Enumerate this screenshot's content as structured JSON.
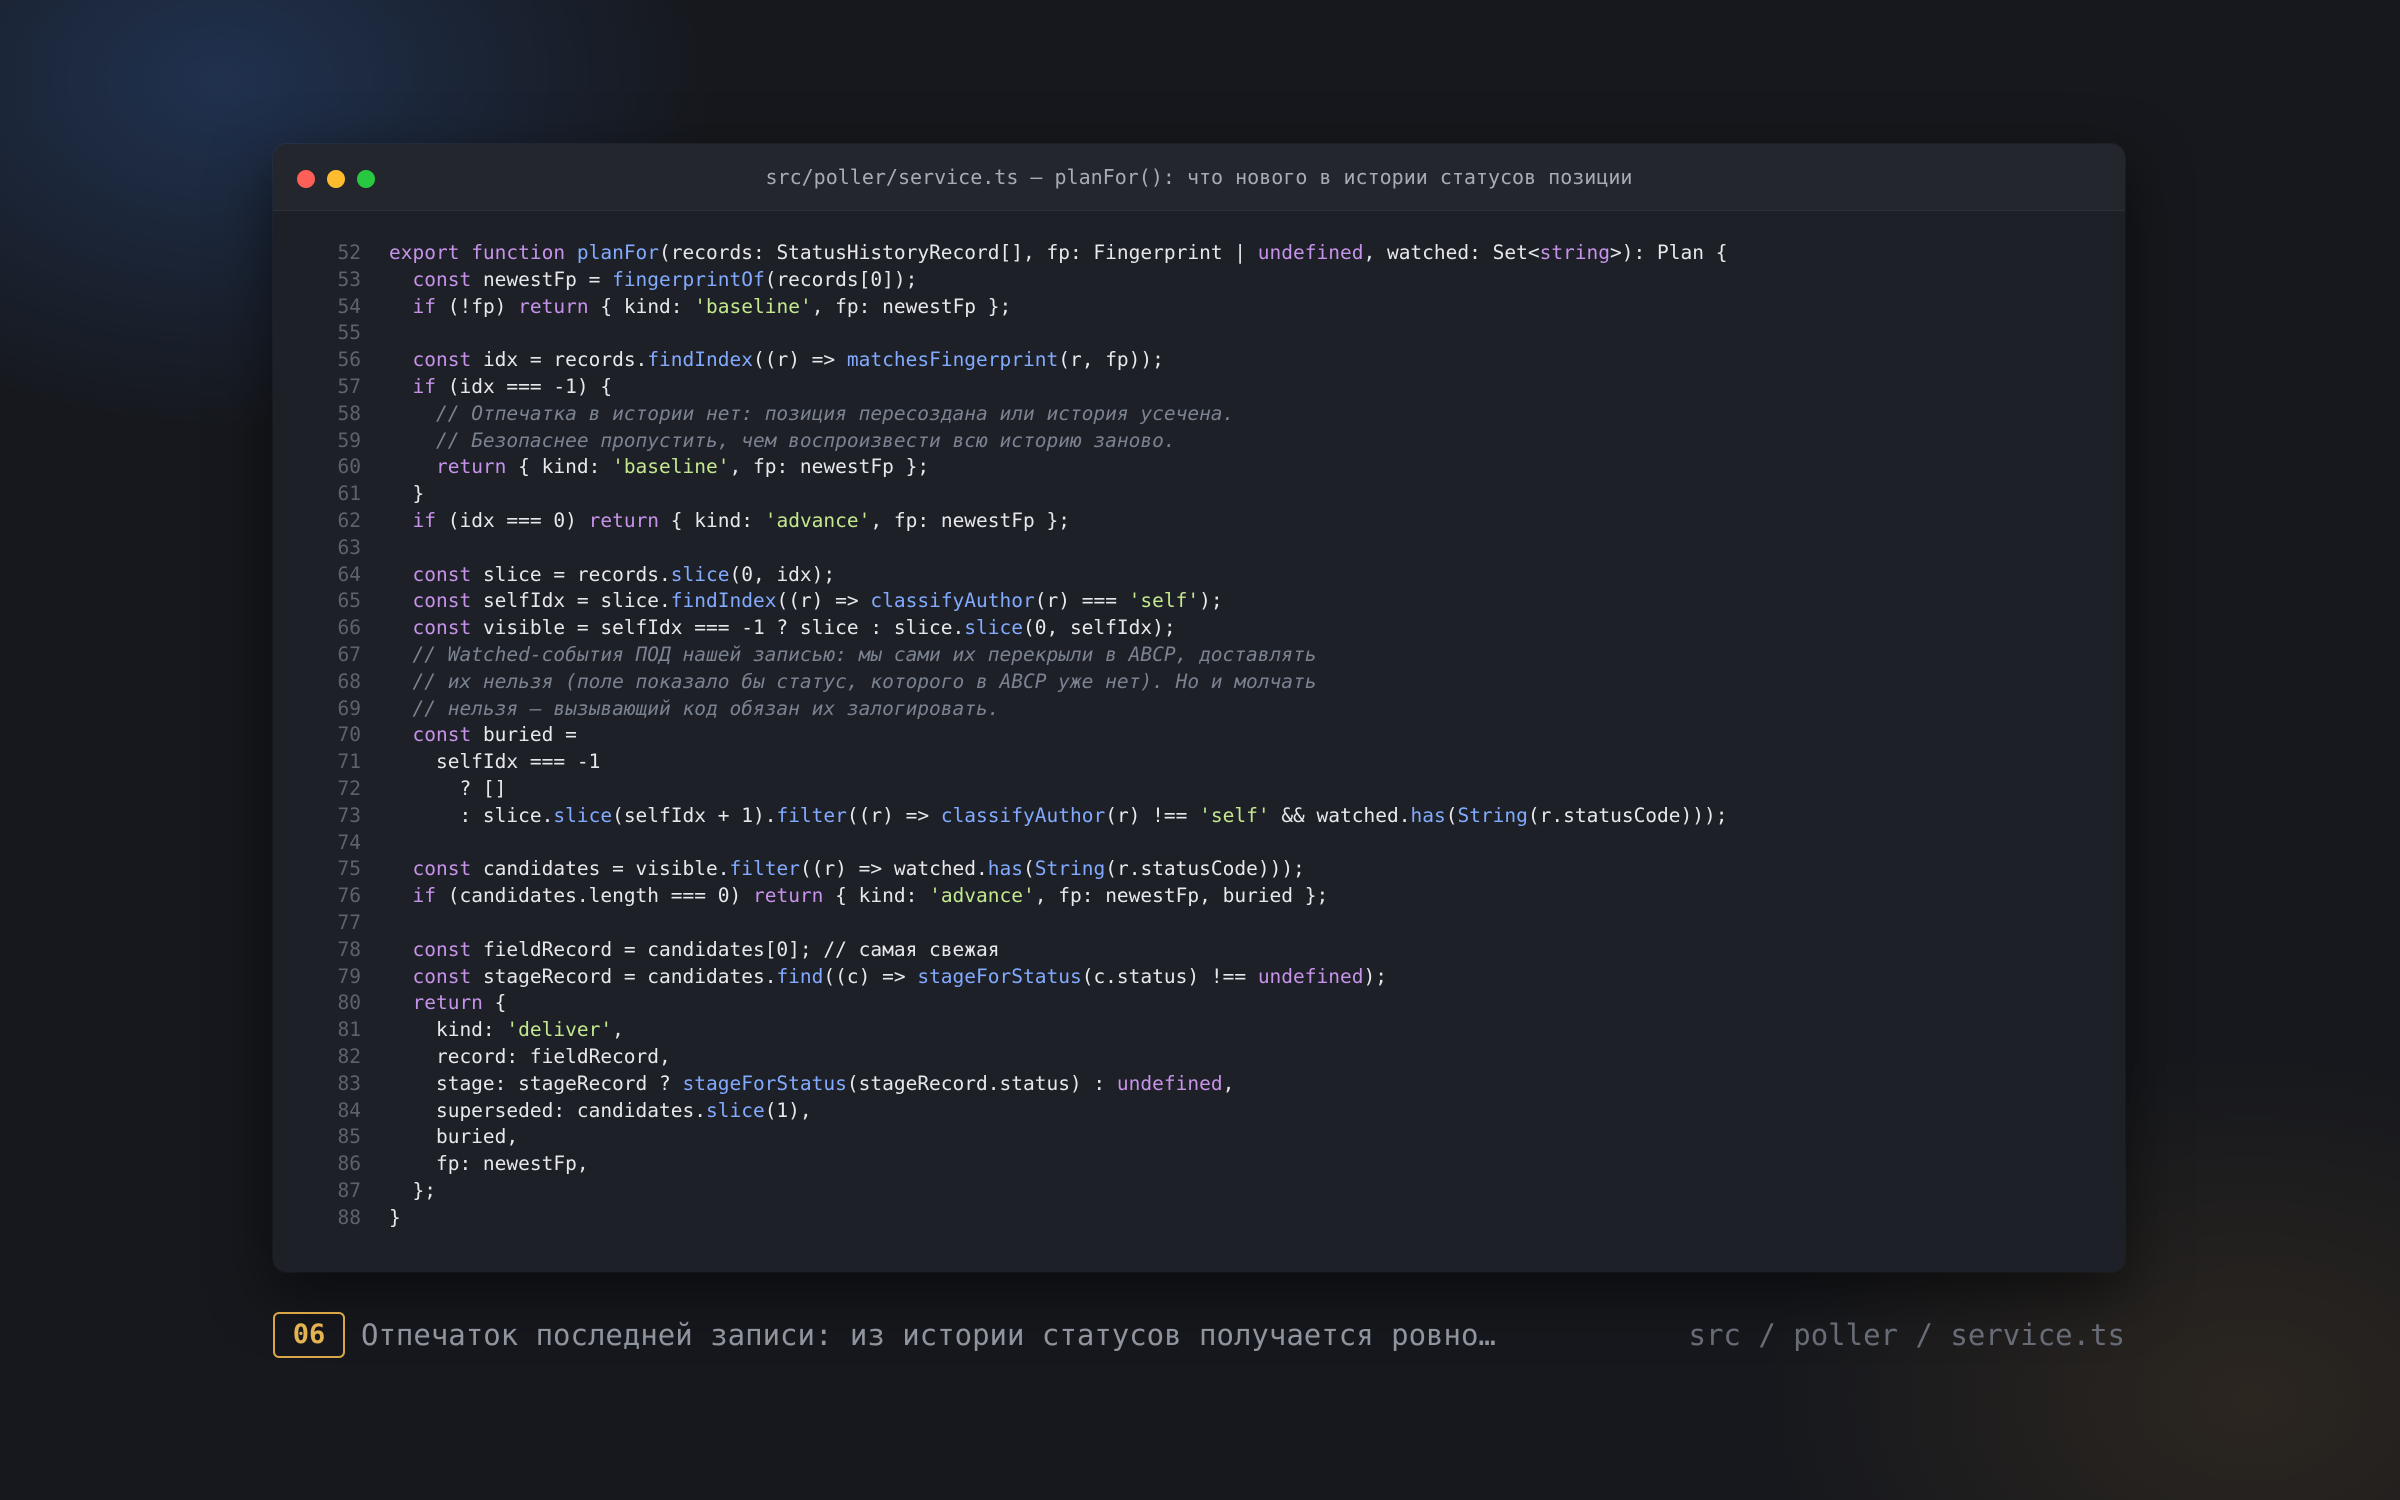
{
  "window": {
    "title": "src/poller/service.ts — planFor(): что нового в истории статусов позиции"
  },
  "code": {
    "lines": [
      {
        "n": "52",
        "t": [
          [
            "k",
            "export "
          ],
          [
            "k",
            "function "
          ],
          [
            "f",
            "planFor"
          ],
          [
            "p",
            "(records: StatusHistoryRecord[], fp: Fingerprint | "
          ],
          [
            "k",
            "undefined"
          ],
          [
            "p",
            ", watched: Set<"
          ],
          [
            "k",
            "string"
          ],
          [
            "p",
            ">): Plan {"
          ]
        ]
      },
      {
        "n": "53",
        "t": [
          [
            "p",
            "  "
          ],
          [
            "k",
            "const "
          ],
          [
            "p",
            "newestFp = "
          ],
          [
            "f",
            "fingerprintOf"
          ],
          [
            "p",
            "(records[0]);"
          ]
        ]
      },
      {
        "n": "54",
        "t": [
          [
            "p",
            "  "
          ],
          [
            "k",
            "if "
          ],
          [
            "p",
            "(!fp) "
          ],
          [
            "k",
            "return "
          ],
          [
            "p",
            "{ kind: "
          ],
          [
            "s",
            "'baseline'"
          ],
          [
            "p",
            ", fp: newestFp };"
          ]
        ]
      },
      {
        "n": "55",
        "t": []
      },
      {
        "n": "56",
        "t": [
          [
            "p",
            "  "
          ],
          [
            "k",
            "const "
          ],
          [
            "p",
            "idx = records."
          ],
          [
            "f",
            "findIndex"
          ],
          [
            "p",
            "((r) => "
          ],
          [
            "f",
            "matchesFingerprint"
          ],
          [
            "p",
            "(r, fp));"
          ]
        ]
      },
      {
        "n": "57",
        "t": [
          [
            "p",
            "  "
          ],
          [
            "k",
            "if "
          ],
          [
            "p",
            "(idx === -1) {"
          ]
        ]
      },
      {
        "n": "58",
        "t": [
          [
            "p",
            "    "
          ],
          [
            "c",
            "// Отпечатка в истории нет: позиция пересоздана или история усечена."
          ]
        ]
      },
      {
        "n": "59",
        "t": [
          [
            "p",
            "    "
          ],
          [
            "c",
            "// Безопаснее пропустить, чем воспроизвести всю историю заново."
          ]
        ]
      },
      {
        "n": "60",
        "t": [
          [
            "p",
            "    "
          ],
          [
            "k",
            "return "
          ],
          [
            "p",
            "{ kind: "
          ],
          [
            "s",
            "'baseline'"
          ],
          [
            "p",
            ", fp: newestFp };"
          ]
        ]
      },
      {
        "n": "61",
        "t": [
          [
            "p",
            "  }"
          ]
        ]
      },
      {
        "n": "62",
        "t": [
          [
            "p",
            "  "
          ],
          [
            "k",
            "if "
          ],
          [
            "p",
            "(idx === 0) "
          ],
          [
            "k",
            "return "
          ],
          [
            "p",
            "{ kind: "
          ],
          [
            "s",
            "'advance'"
          ],
          [
            "p",
            ", fp: newestFp };"
          ]
        ]
      },
      {
        "n": "63",
        "t": []
      },
      {
        "n": "64",
        "t": [
          [
            "p",
            "  "
          ],
          [
            "k",
            "const "
          ],
          [
            "p",
            "slice = records."
          ],
          [
            "f",
            "slice"
          ],
          [
            "p",
            "(0, idx);"
          ]
        ]
      },
      {
        "n": "65",
        "t": [
          [
            "p",
            "  "
          ],
          [
            "k",
            "const "
          ],
          [
            "p",
            "selfIdx = slice."
          ],
          [
            "f",
            "findIndex"
          ],
          [
            "p",
            "((r) => "
          ],
          [
            "f",
            "classifyAuthor"
          ],
          [
            "p",
            "(r) === "
          ],
          [
            "s",
            "'self'"
          ],
          [
            "p",
            ");"
          ]
        ]
      },
      {
        "n": "66",
        "t": [
          [
            "p",
            "  "
          ],
          [
            "k",
            "const "
          ],
          [
            "p",
            "visible = selfIdx === -1 ? slice : slice."
          ],
          [
            "f",
            "slice"
          ],
          [
            "p",
            "(0, selfIdx);"
          ]
        ]
      },
      {
        "n": "67",
        "t": [
          [
            "p",
            "  "
          ],
          [
            "c",
            "// Watched-события ПОД нашей записью: мы сами их перекрыли в АВСР, доставлять"
          ]
        ]
      },
      {
        "n": "68",
        "t": [
          [
            "p",
            "  "
          ],
          [
            "c",
            "// их нельзя (поле показало бы статус, которого в АВСР уже нет). Но и молчать"
          ]
        ]
      },
      {
        "n": "69",
        "t": [
          [
            "p",
            "  "
          ],
          [
            "c",
            "// нельзя — вызывающий код обязан их залогировать."
          ]
        ]
      },
      {
        "n": "70",
        "t": [
          [
            "p",
            "  "
          ],
          [
            "k",
            "const "
          ],
          [
            "p",
            "buried ="
          ]
        ]
      },
      {
        "n": "71",
        "t": [
          [
            "p",
            "    selfIdx === -1"
          ]
        ]
      },
      {
        "n": "72",
        "t": [
          [
            "p",
            "      ? []"
          ]
        ]
      },
      {
        "n": "73",
        "t": [
          [
            "p",
            "      : slice."
          ],
          [
            "f",
            "slice"
          ],
          [
            "p",
            "(selfIdx + 1)."
          ],
          [
            "f",
            "filter"
          ],
          [
            "p",
            "((r) => "
          ],
          [
            "f",
            "classifyAuthor"
          ],
          [
            "p",
            "(r) !== "
          ],
          [
            "s",
            "'self'"
          ],
          [
            "p",
            " && watched."
          ],
          [
            "f",
            "has"
          ],
          [
            "p",
            "("
          ],
          [
            "f",
            "String"
          ],
          [
            "p",
            "(r.statusCode)));"
          ]
        ]
      },
      {
        "n": "74",
        "t": []
      },
      {
        "n": "75",
        "t": [
          [
            "p",
            "  "
          ],
          [
            "k",
            "const "
          ],
          [
            "p",
            "candidates = visible."
          ],
          [
            "f",
            "filter"
          ],
          [
            "p",
            "((r) => watched."
          ],
          [
            "f",
            "has"
          ],
          [
            "p",
            "("
          ],
          [
            "f",
            "String"
          ],
          [
            "p",
            "(r.statusCode)));"
          ]
        ]
      },
      {
        "n": "76",
        "t": [
          [
            "p",
            "  "
          ],
          [
            "k",
            "if "
          ],
          [
            "p",
            "(candidates.length === 0) "
          ],
          [
            "k",
            "return "
          ],
          [
            "p",
            "{ kind: "
          ],
          [
            "s",
            "'advance'"
          ],
          [
            "p",
            ", fp: newestFp, buried };"
          ]
        ]
      },
      {
        "n": "77",
        "t": []
      },
      {
        "n": "78",
        "t": [
          [
            "p",
            "  "
          ],
          [
            "k",
            "const "
          ],
          [
            "p",
            "fieldRecord = candidates[0]; // самая свежая"
          ]
        ]
      },
      {
        "n": "79",
        "t": [
          [
            "p",
            "  "
          ],
          [
            "k",
            "const "
          ],
          [
            "p",
            "stageRecord = candidates."
          ],
          [
            "f",
            "find"
          ],
          [
            "p",
            "((c) => "
          ],
          [
            "f",
            "stageForStatus"
          ],
          [
            "p",
            "(c.status) !== "
          ],
          [
            "k",
            "undefined"
          ],
          [
            "p",
            ");"
          ]
        ]
      },
      {
        "n": "80",
        "t": [
          [
            "p",
            "  "
          ],
          [
            "k",
            "return "
          ],
          [
            "p",
            "{"
          ]
        ]
      },
      {
        "n": "81",
        "t": [
          [
            "p",
            "    kind: "
          ],
          [
            "s",
            "'deliver'"
          ],
          [
            "p",
            ","
          ]
        ]
      },
      {
        "n": "82",
        "t": [
          [
            "p",
            "    record: fieldRecord,"
          ]
        ]
      },
      {
        "n": "83",
        "t": [
          [
            "p",
            "    stage: stageRecord ? "
          ],
          [
            "f",
            "stageForStatus"
          ],
          [
            "p",
            "(stageRecord.status) : "
          ],
          [
            "k",
            "undefined"
          ],
          [
            "p",
            ","
          ]
        ]
      },
      {
        "n": "84",
        "t": [
          [
            "p",
            "    superseded: candidates."
          ],
          [
            "f",
            "slice"
          ],
          [
            "p",
            "(1),"
          ]
        ]
      },
      {
        "n": "85",
        "t": [
          [
            "p",
            "    buried,"
          ]
        ]
      },
      {
        "n": "86",
        "t": [
          [
            "p",
            "    fp: newestFp,"
          ]
        ]
      },
      {
        "n": "87",
        "t": [
          [
            "p",
            "  };"
          ]
        ]
      },
      {
        "n": "88",
        "t": [
          [
            "p",
            "}"
          ]
        ]
      }
    ]
  },
  "caption": {
    "badge": "06",
    "text": "Отпечаток последней записи: из истории статусов получается ровно одно действие",
    "path": "src / poller / service.ts"
  }
}
